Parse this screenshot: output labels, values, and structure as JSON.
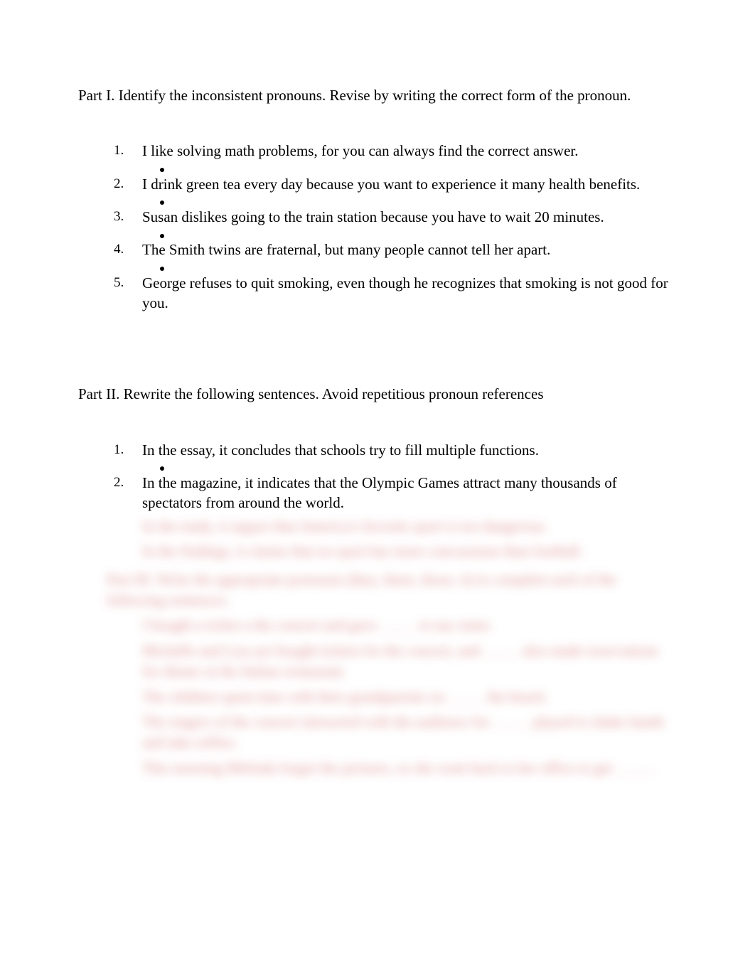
{
  "part1": {
    "heading": "Part I. Identify the inconsistent pronouns. Revise by writing the correct form of the pronoun.",
    "items": [
      "I like solving math problems, for you can always find the correct answer.",
      "I drink green tea every day because you want to experience it many health benefits.",
      "Susan dislikes going to the train station because you have to wait 20 minutes.",
      "The Smith twins are fraternal, but many people cannot tell her apart.",
      "George refuses to quit smoking, even though he recognizes that smoking is not good for you."
    ]
  },
  "part2": {
    "heading": "Part II. Rewrite the following sentences. Avoid repetitious pronoun references",
    "items": [
      "In the essay, it concludes that schools try to fill multiple functions.",
      "In the magazine, it indicates that the Olympic Games attract many thousands of spectators from around the world."
    ]
  },
  "obscured": {
    "item3": "In the study, it argues that America's favorite sport is too dangerous.",
    "item4": "In the findings, it claims that no sport has more concussions than football.",
    "part3_heading": "Part III. Write the appropriate pronouns (they, them, those, it) to complete each of the following sentences.",
    "p3_1_a": "I bought a ticket a the concert and gave",
    "p3_1_b": "to my sister.",
    "p3_2_a": "Michelle and Lisa are bought tickets for the concert, and",
    "p3_2_b": "also made reservations for dinner at the Italian restaurant.",
    "p3_3_a": "The children spent time with their grandparents on",
    "p3_3_b": "the beach.",
    "p3_4_a": "The singers of the concert interacted with the audience for",
    "p3_4_b": "played to shake hands and take selfies.",
    "p3_5": "This morning Melinda forgot the pictures, so she went back to her office to get"
  }
}
